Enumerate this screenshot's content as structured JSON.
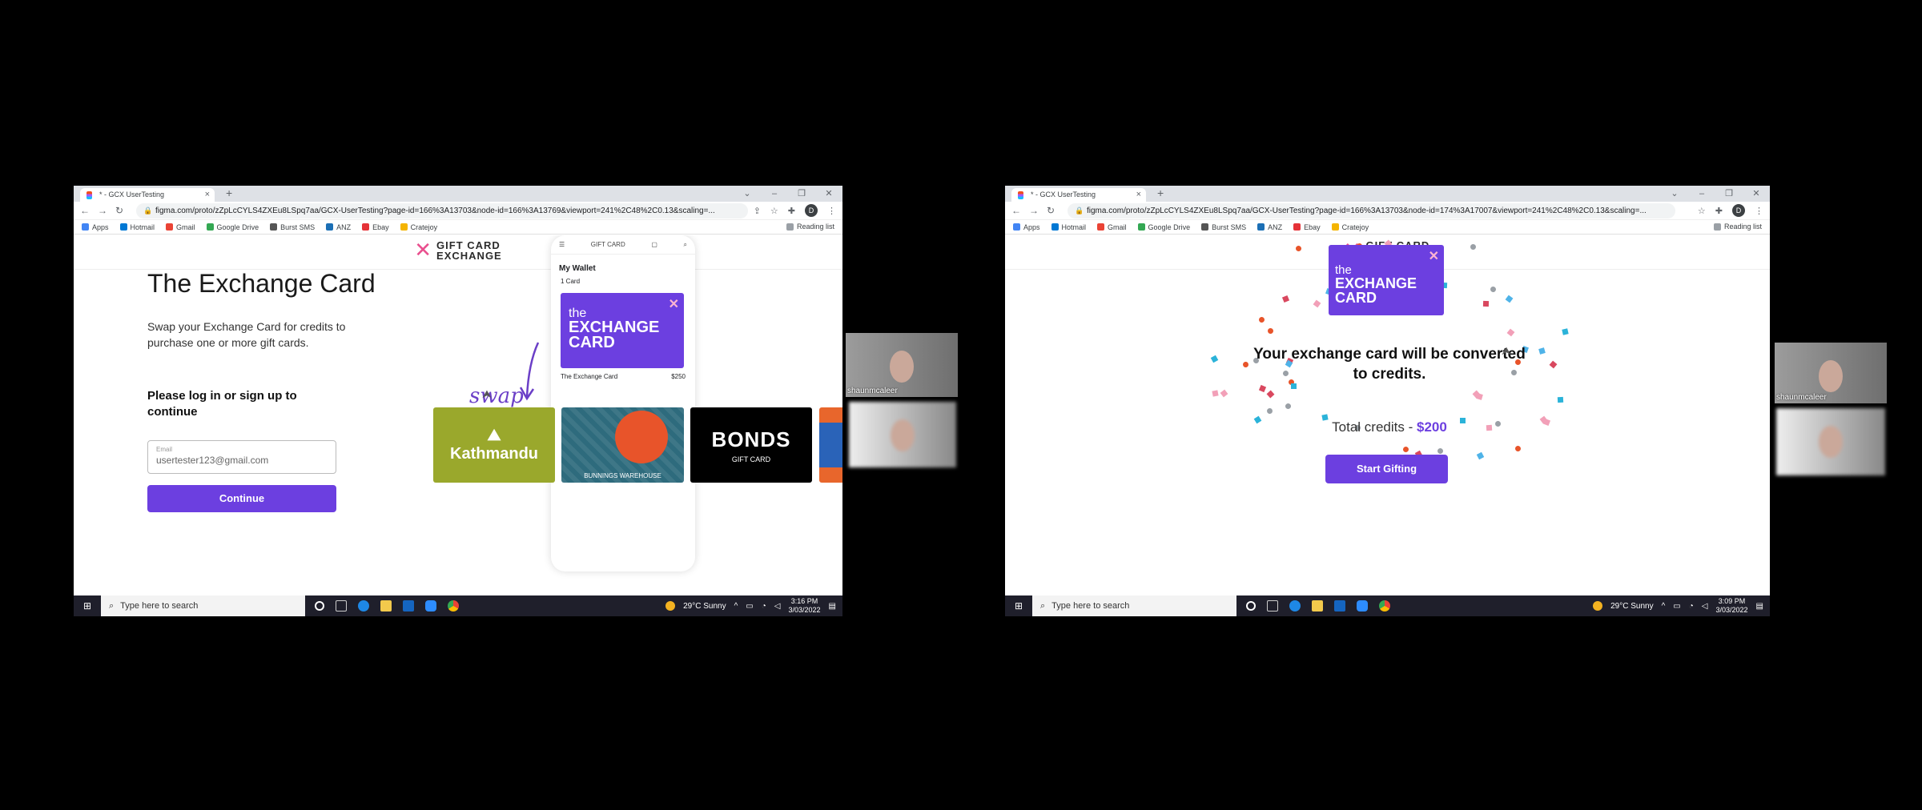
{
  "browser": {
    "tab_title": "* - GCX UserTesting",
    "tab_close": "×",
    "new_tab": "+",
    "win_min": "⌄",
    "win_minimize": "–",
    "win_restore": "❐",
    "win_close": "✕",
    "back": "←",
    "forward": "→",
    "reload": "↻",
    "lock": "🔒",
    "url_left": "figma.com/proto/zZpLcCYLS4ZXEu8LSpq7aa/GCX-UserTesting?page-id=166%3A13703&node-id=166%3A13769&viewport=241%2C48%2C0.13&scaling=...",
    "url_right": "figma.com/proto/zZpLcCYLS4ZXEu8LSpq7aa/GCX-UserTesting?page-id=166%3A13703&node-id=174%3A17007&viewport=241%2C48%2C0.13&scaling=...",
    "profile": "D",
    "bookmarks": [
      "Apps",
      "Hotmail",
      "Gmail",
      "Google Drive",
      "Burst SMS",
      "ANZ",
      "Ebay",
      "Cratejoy"
    ],
    "bookmark_colors": [
      "#4285f4",
      "#0078d4",
      "#ea4335",
      "#34a853",
      "#555555",
      "#1b6fb5",
      "#e53238",
      "#f4b400"
    ],
    "reading_list": "Reading list"
  },
  "brand": {
    "logo_mark": "✕",
    "logo_line1": "GIFT CARD",
    "logo_line2": "EXCHANGE",
    "accent": "#6c3fe0"
  },
  "screen1": {
    "heading": "The Exchange Card",
    "subtitle": "Swap your Exchange Card for credits to purchase one or more gift cards.",
    "login_prompt": "Please log in or sign up to continue",
    "email_label": "Email",
    "email_value": "usertester123@gmail.com",
    "continue_label": "Continue",
    "swap_label": "swap",
    "phone": {
      "wallet_title": "My Wallet",
      "card_count": "1 Card",
      "card_name": "The Exchange Card",
      "card_value": "$250"
    },
    "gift_cards": {
      "kathmandu": "Kathmandu",
      "bunnings": "BUNNINGS WAREHOUSE",
      "bonds": "BONDS",
      "bonds_sub": "GIFT CARD"
    }
  },
  "exchange_card": {
    "the": "the",
    "line1": "EXCHANGE",
    "line2": "CARD"
  },
  "screen2": {
    "message": "Your exchange card will be converted to credits.",
    "total_label": "Total credits - ",
    "total_value": "$200",
    "start_label": "Start Gifting"
  },
  "taskbar": {
    "start_icon": "⊞",
    "search_icon": "⌕",
    "search_placeholder": "Type here to search",
    "weather1": "29°C  Sunny",
    "time1": "3:16 PM",
    "date1": "3/03/2022",
    "weather2": "29°C  Sunny",
    "time2": "3:09 PM",
    "date2": "3/03/2022"
  },
  "video": {
    "participant_name": "shaunmcaleer"
  }
}
